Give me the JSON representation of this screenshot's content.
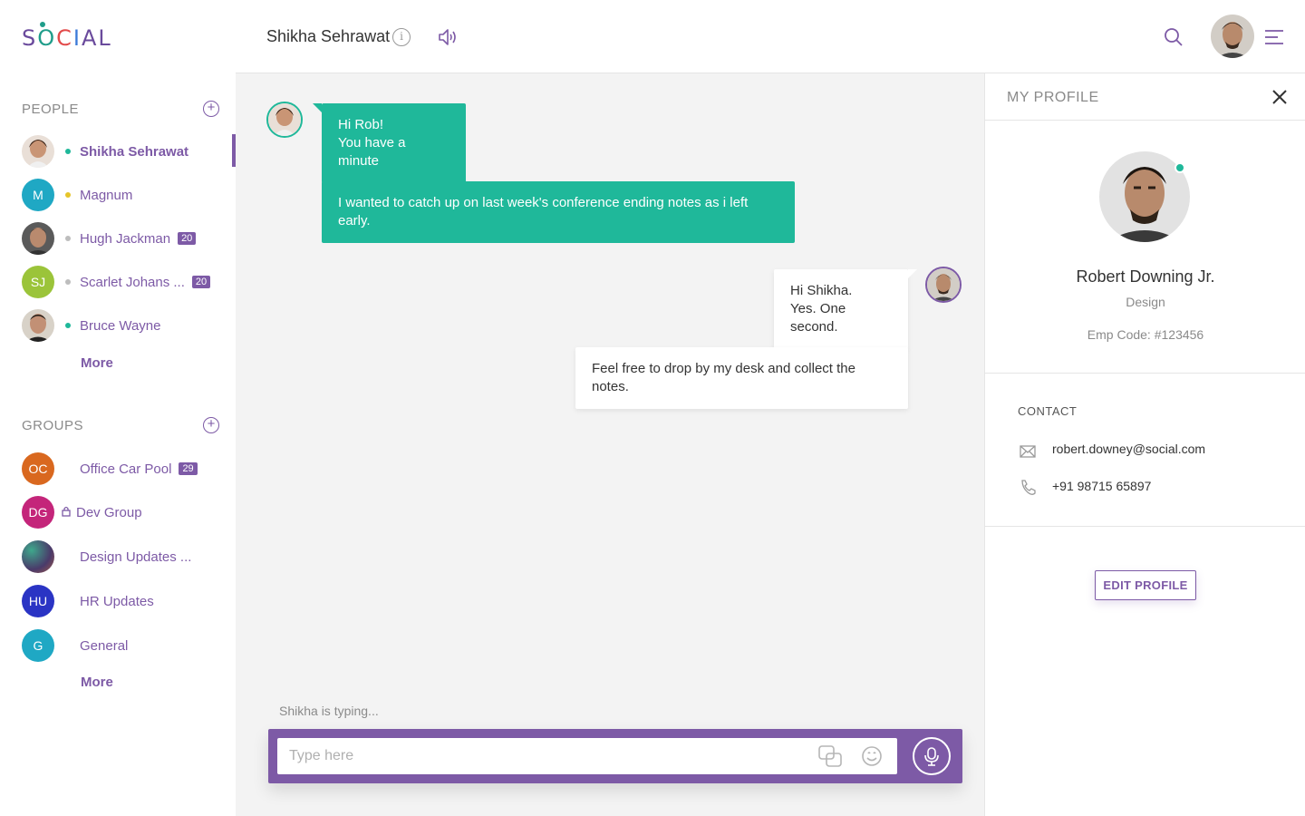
{
  "app": {
    "logo": {
      "letters": [
        "S",
        "O",
        "C",
        "I",
        "A",
        "L"
      ]
    }
  },
  "sidebar": {
    "people_title": "PEOPLE",
    "people": [
      {
        "name": "Shikha Sehrawat",
        "presence": "#1fb89a",
        "active": true
      },
      {
        "name": "Magnum",
        "initials": "M",
        "avatar_color": "#1fa8c4",
        "presence": "#e6c52a"
      },
      {
        "name": "Hugh Jackman",
        "presence": "#bdbdbd",
        "badge": "20"
      },
      {
        "name": "Scarlet Johans ...",
        "initials": "SJ",
        "avatar_color": "#9bc43a",
        "presence": "#bdbdbd",
        "badge": "20"
      },
      {
        "name": "Bruce Wayne",
        "presence": "#1fb89a"
      }
    ],
    "people_more": "More",
    "groups_title": "GROUPS",
    "groups": [
      {
        "name": "Office Car Pool",
        "initials": "OC",
        "avatar_color": "#d9681f",
        "badge": "29"
      },
      {
        "name": "Dev Group",
        "initials": "DG",
        "avatar_color": "#c4257a",
        "locked": true
      },
      {
        "name": "Design Updates ..."
      },
      {
        "name": "HR Updates",
        "initials": "HU",
        "avatar_color": "#2a34c4"
      },
      {
        "name": "General",
        "initials": "G",
        "avatar_color": "#1fa8c4"
      }
    ],
    "groups_more": "More"
  },
  "topbar": {
    "chat_title": "Shikha Sehrawat",
    "info_glyph": "i"
  },
  "chat": {
    "messages": [
      {
        "from": "Shikha Sehrawat",
        "direction": "in",
        "lines": [
          "Hi Rob!",
          "You have a minute"
        ]
      },
      {
        "from": "Shikha Sehrawat",
        "direction": "in",
        "lines": [
          "I wanted to catch up on last week's conference ending notes as i left early."
        ]
      },
      {
        "from": "Robert Downing Jr.",
        "direction": "out",
        "lines": [
          "Hi Shikha.",
          "Yes. One second."
        ]
      },
      {
        "from": "Robert Downing Jr.",
        "direction": "out",
        "lines": [
          "Feel free to drop by my desk and collect the notes."
        ]
      }
    ],
    "typing_indicator": "Shikha is typing...",
    "composer_placeholder": "Type here"
  },
  "profile": {
    "title": "MY PROFILE",
    "name": "Robert Downing Jr.",
    "department": "Design",
    "emp_code": "Emp Code: #123456",
    "contact_title": "CONTACT",
    "email": "robert.downey@social.com",
    "phone": "+91 98715 65897",
    "edit_label": "EDIT PROFILE"
  },
  "colors": {
    "accent": "#7d5aa6",
    "incoming_bubble": "#1fb89a",
    "online": "#1fb89a"
  }
}
